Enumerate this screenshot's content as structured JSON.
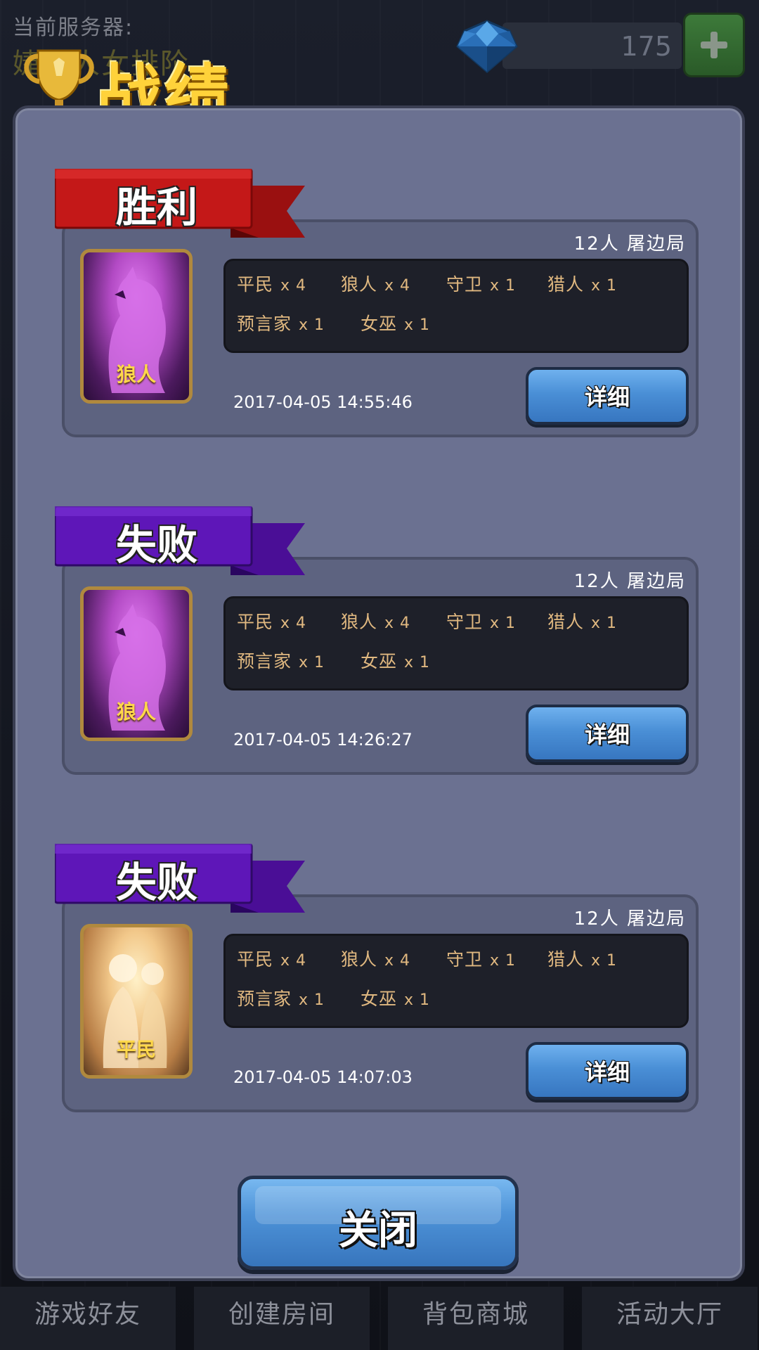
{
  "topbar": {
    "server_label": "当前服务器:",
    "server_name": "婕部人女排阶",
    "gems": "175"
  },
  "title": "战绩",
  "records": [
    {
      "result": "胜利",
      "result_color": "#c41818",
      "meta": "12人  屠边局",
      "role": "狼人",
      "role_type": "wolf",
      "roles": [
        {
          "name": "平民",
          "count": "x 4"
        },
        {
          "name": "狼人",
          "count": "x 4"
        },
        {
          "name": "守卫",
          "count": "x 1"
        },
        {
          "name": "猎人",
          "count": "x 1"
        },
        {
          "name": "预言家",
          "count": "x 1"
        },
        {
          "name": "女巫",
          "count": "x 1"
        }
      ],
      "time": "2017-04-05 14:55:46",
      "detail_label": "详细"
    },
    {
      "result": "失败",
      "result_color": "#5e16b8",
      "meta": "12人  屠边局",
      "role": "狼人",
      "role_type": "wolf",
      "roles": [
        {
          "name": "平民",
          "count": "x 4"
        },
        {
          "name": "狼人",
          "count": "x 4"
        },
        {
          "name": "守卫",
          "count": "x 1"
        },
        {
          "name": "猎人",
          "count": "x 1"
        },
        {
          "name": "预言家",
          "count": "x 1"
        },
        {
          "name": "女巫",
          "count": "x 1"
        }
      ],
      "time": "2017-04-05 14:26:27",
      "detail_label": "详细"
    },
    {
      "result": "失败",
      "result_color": "#5e16b8",
      "meta": "12人  屠边局",
      "role": "平民",
      "role_type": "civilian",
      "roles": [
        {
          "name": "平民",
          "count": "x 4"
        },
        {
          "name": "狼人",
          "count": "x 4"
        },
        {
          "name": "守卫",
          "count": "x 1"
        },
        {
          "name": "猎人",
          "count": "x 1"
        },
        {
          "name": "预言家",
          "count": "x 1"
        },
        {
          "name": "女巫",
          "count": "x 1"
        }
      ],
      "time": "2017-04-05 14:07:03",
      "detail_label": "详细"
    }
  ],
  "close_label": "关闭",
  "nav": [
    "游戏好友",
    "创建房间",
    "背包商城",
    "活动大厅"
  ],
  "icons": {
    "gem": "diamond-icon",
    "add": "plus-icon",
    "trophy": "trophy-icon"
  }
}
